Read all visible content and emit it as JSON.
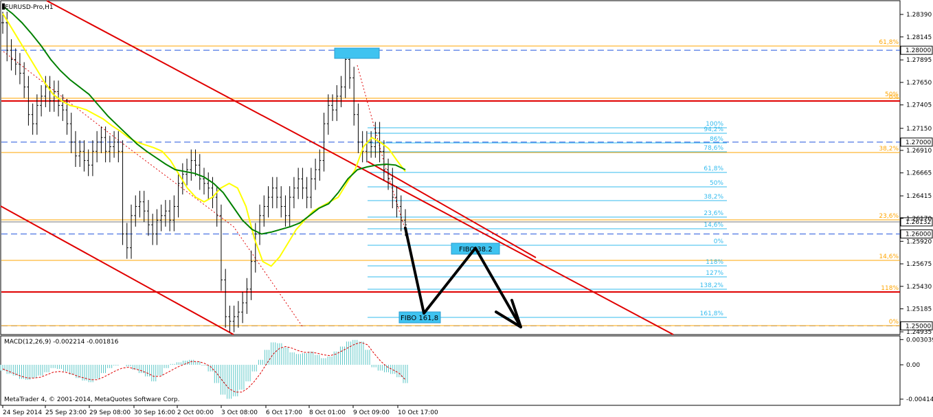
{
  "window": {
    "title": "EURUSD-Pro,H1"
  },
  "watermark": "MetaTrader 4, © 2001-2014, MetaQuotes Software Corp.",
  "colors": {
    "bars": "#000000",
    "ma_fast": "#ffff00",
    "ma_slow": "#008000",
    "channel": "#e00000",
    "fib_left": "#ffa500",
    "fib_right": "#33bbee",
    "hline": "#2255dd",
    "box": "#3fc3f0",
    "macd_hist": "#5bc7c7",
    "macd_signal": "#e00000"
  },
  "chart_data": [
    {
      "type": "line",
      "title": "EURUSD-Pro,H1",
      "y_ticks": [
        "1.28390",
        "1.28145",
        "1.27895",
        "1.27650",
        "1.27405",
        "1.27150",
        "1.26910",
        "1.26665",
        "1.26415",
        "1.26170",
        "1.25920",
        "1.25675",
        "1.25430",
        "1.25185",
        "1.24935"
      ],
      "ylim": [
        1.249,
        1.2848
      ],
      "x_ticks": [
        "24 Sep 2014",
        "25 Sep 23:00",
        "29 Sep 08:00",
        "30 Sep 16:00",
        "2 Oct 00:00",
        "3 Oct 08:00",
        "6 Oct 17:00",
        "8 Oct 01:00",
        "9 Oct 09:00",
        "10 Oct 17:00"
      ],
      "price_series": {
        "name": "EURUSD H1",
        "points": [
          1.283,
          1.28,
          1.279,
          1.2785,
          1.2775,
          1.276,
          1.273,
          1.272,
          1.274,
          1.275,
          1.276,
          1.2745,
          1.2755,
          1.274,
          1.2735,
          1.272,
          1.27,
          1.2685,
          1.269,
          1.268,
          1.2675,
          1.269,
          1.27,
          1.2705,
          1.269,
          1.2695,
          1.27,
          1.269,
          1.26,
          1.2585,
          1.262,
          1.263,
          1.2635,
          1.2625,
          1.261,
          1.26,
          1.2615,
          1.262,
          1.2625,
          1.2615,
          1.263,
          1.2655,
          1.2665,
          1.267,
          1.268,
          1.2675,
          1.266,
          1.2655,
          1.265,
          1.264,
          1.262,
          1.255,
          1.251,
          1.2505,
          1.251,
          1.2515,
          1.2525,
          1.254,
          1.257,
          1.26,
          1.262,
          1.263,
          1.264,
          1.265,
          1.264,
          1.263,
          1.262,
          1.264,
          1.265,
          1.266,
          1.265,
          1.264,
          1.266,
          1.267,
          1.268,
          1.272,
          1.274,
          1.2735,
          1.275,
          1.276,
          1.279,
          1.277,
          1.273,
          1.27,
          1.269,
          1.27,
          1.2695,
          1.271,
          1.269,
          1.267,
          1.266,
          1.264,
          1.263,
          1.2615,
          1.261
        ]
      },
      "ma_fast": {
        "name": "MA fast",
        "points": [
          1.284,
          1.2825,
          1.281,
          1.2795,
          1.278,
          1.2765,
          1.2752,
          1.2745,
          1.274,
          1.2738,
          1.2735,
          1.273,
          1.2725,
          1.2718,
          1.2712,
          1.2705,
          1.27,
          1.2697,
          1.2694,
          1.269,
          1.268,
          1.2665,
          1.265,
          1.264,
          1.2635,
          1.264,
          1.265,
          1.2655,
          1.265,
          1.263,
          1.2595,
          1.257,
          1.2565,
          1.2575,
          1.259,
          1.2605,
          1.2615,
          1.2625,
          1.263,
          1.2635,
          1.264,
          1.2655,
          1.267,
          1.2695,
          1.2705,
          1.27,
          1.2693,
          1.268,
          1.2668
        ]
      },
      "ma_slow": {
        "name": "MA slow",
        "points": [
          1.2848,
          1.284,
          1.283,
          1.2818,
          1.2805,
          1.279,
          1.2778,
          1.2768,
          1.276,
          1.2752,
          1.274,
          1.2728,
          1.2718,
          1.2708,
          1.2698,
          1.269,
          1.2683,
          1.2676,
          1.267,
          1.2668,
          1.2666,
          1.2662,
          1.2655,
          1.2645,
          1.263,
          1.2615,
          1.2605,
          1.26,
          1.2602,
          1.2605,
          1.2608,
          1.2612,
          1.262,
          1.2628,
          1.2633,
          1.2645,
          1.266,
          1.267,
          1.2673,
          1.2675,
          1.2676,
          1.2675,
          1.267
        ]
      },
      "horizontal_levels": [
        "1.28000",
        "1.27000",
        "1.26000",
        "1.25000"
      ],
      "current_price": "1.26132",
      "fib_left_labels": [
        "61,8%",
        "50%",
        "0%",
        "38,2%",
        "23,6%",
        "14,6%",
        "118%",
        "0%"
      ],
      "fib_right_labels": [
        "100%",
        "94,2%",
        "86%",
        "78,6%",
        "61,8%",
        "50%",
        "38,2%",
        "23,6%",
        "14,6%",
        "0%",
        "118%",
        "127%",
        "138,2%",
        "161,8%"
      ],
      "annotations": [
        "FIBO 38.2",
        "FIBO 161,8"
      ]
    },
    {
      "type": "bar",
      "title": "MACD(12,26,9) -0.002214 -0.001816",
      "y_ticks": [
        "0.003039",
        "0.00",
        "-0.004141"
      ],
      "ylim": [
        -0.004141,
        0.003039
      ],
      "series": [
        {
          "name": "MACD",
          "values": [
            -0.0007,
            -0.0011,
            -0.0013,
            -0.0017,
            -0.0018,
            -0.0016,
            -0.0013,
            -0.0009,
            -0.0004,
            -0.0005,
            -0.0008,
            -0.0012,
            -0.0016,
            -0.0019,
            -0.0021,
            -0.0017,
            -0.001,
            -0.0004,
            -0.0001,
            0.0,
            -0.0002,
            -0.0006,
            -0.001,
            -0.0014,
            -0.002,
            -0.0013,
            -0.0004,
            0.0001,
            0.0003,
            0.0005,
            0.0006,
            0.0004,
            -0.0001,
            -0.0008,
            -0.0022,
            -0.0036,
            -0.0041,
            -0.0038,
            -0.003,
            -0.002,
            -0.0008,
            0.0006,
            0.0018,
            0.0027,
            0.0026,
            0.0021,
            0.0015,
            0.0013,
            0.0014,
            0.0016,
            0.0012,
            0.0008,
            0.001,
            0.0016,
            0.0022,
            0.0028,
            0.003,
            0.0028,
            0.0018,
            -0.0003,
            -0.0007,
            -0.0009,
            -0.0011,
            -0.0015,
            -0.0022
          ]
        },
        {
          "name": "Signal",
          "values": [
            -0.0005,
            -0.0008,
            -0.0011,
            -0.0014,
            -0.0016,
            -0.0016,
            -0.0015,
            -0.0012,
            -0.0009,
            -0.0008,
            -0.0009,
            -0.0011,
            -0.0014,
            -0.0016,
            -0.0018,
            -0.0018,
            -0.0015,
            -0.0011,
            -0.0007,
            -0.0004,
            -0.0003,
            -0.0005,
            -0.0007,
            -0.001,
            -0.0014,
            -0.0014,
            -0.001,
            -0.0006,
            -0.0002,
            0.0001,
            0.0004,
            0.0004,
            0.0002,
            -0.0002,
            -0.001,
            -0.002,
            -0.0029,
            -0.0033,
            -0.0033,
            -0.0028,
            -0.002,
            -0.001,
            0.0002,
            0.0013,
            0.002,
            0.0022,
            0.002,
            0.0017,
            0.0015,
            0.0015,
            0.0014,
            0.0012,
            0.0011,
            0.0013,
            0.0017,
            0.0021,
            0.0025,
            0.0027,
            0.0024,
            0.0014,
            0.0005,
            -0.0002,
            -0.0006,
            -0.001,
            -0.0018
          ]
        }
      ]
    }
  ]
}
